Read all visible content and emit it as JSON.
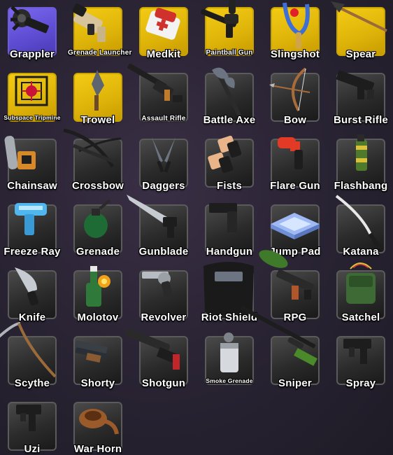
{
  "inventory": {
    "items": [
      {
        "label": "Grappler",
        "rarity": "purple",
        "icon": "grappler-icon"
      },
      {
        "label": "Grenade Launcher",
        "rarity": "gold",
        "icon": "grenade-launcher-icon"
      },
      {
        "label": "Medkit",
        "rarity": "gold",
        "icon": "medkit-icon"
      },
      {
        "label": "Paintball Gun",
        "rarity": "gold",
        "icon": "paintball-gun-icon"
      },
      {
        "label": "Slingshot",
        "rarity": "gold",
        "icon": "slingshot-icon"
      },
      {
        "label": "Spear",
        "rarity": "gold",
        "icon": "spear-icon"
      },
      {
        "label": "Subspace Tripmine",
        "rarity": "gold",
        "icon": "subspace-tripmine-icon"
      },
      {
        "label": "Trowel",
        "rarity": "gold",
        "icon": "trowel-icon"
      },
      {
        "label": "Assault Rifle",
        "rarity": "common",
        "icon": "assault-rifle-icon"
      },
      {
        "label": "Battle Axe",
        "rarity": "common",
        "icon": "battle-axe-icon"
      },
      {
        "label": "Bow",
        "rarity": "common",
        "icon": "bow-icon"
      },
      {
        "label": "Burst Rifle",
        "rarity": "common",
        "icon": "burst-rifle-icon"
      },
      {
        "label": "Chainsaw",
        "rarity": "common",
        "icon": "chainsaw-icon"
      },
      {
        "label": "Crossbow",
        "rarity": "common",
        "icon": "crossbow-icon"
      },
      {
        "label": "Daggers",
        "rarity": "common",
        "icon": "daggers-icon"
      },
      {
        "label": "Fists",
        "rarity": "common",
        "icon": "fists-icon"
      },
      {
        "label": "Flare Gun",
        "rarity": "common",
        "icon": "flare-gun-icon"
      },
      {
        "label": "Flashbang",
        "rarity": "common",
        "icon": "flashbang-icon"
      },
      {
        "label": "Freeze Ray",
        "rarity": "common",
        "icon": "freeze-ray-icon"
      },
      {
        "label": "Grenade",
        "rarity": "common",
        "icon": "grenade-icon"
      },
      {
        "label": "Gunblade",
        "rarity": "common",
        "icon": "gunblade-icon"
      },
      {
        "label": "Handgun",
        "rarity": "common",
        "icon": "handgun-icon"
      },
      {
        "label": "Jump Pad",
        "rarity": "common",
        "icon": "jump-pad-icon"
      },
      {
        "label": "Katana",
        "rarity": "common",
        "icon": "katana-icon"
      },
      {
        "label": "Knife",
        "rarity": "common",
        "icon": "knife-icon"
      },
      {
        "label": "Molotov",
        "rarity": "common",
        "icon": "molotov-icon"
      },
      {
        "label": "Revolver",
        "rarity": "common",
        "icon": "revolver-icon"
      },
      {
        "label": "Riot Shield",
        "rarity": "common",
        "icon": "riot-shield-icon"
      },
      {
        "label": "RPG",
        "rarity": "common",
        "icon": "rpg-icon"
      },
      {
        "label": "Satchel",
        "rarity": "common",
        "icon": "satchel-icon"
      },
      {
        "label": "Scythe",
        "rarity": "common",
        "icon": "scythe-icon"
      },
      {
        "label": "Shorty",
        "rarity": "common",
        "icon": "shorty-icon"
      },
      {
        "label": "Shotgun",
        "rarity": "common",
        "icon": "shotgun-icon"
      },
      {
        "label": "Smoke Grenade",
        "rarity": "common",
        "icon": "smoke-grenade-icon"
      },
      {
        "label": "Sniper",
        "rarity": "common",
        "icon": "sniper-icon"
      },
      {
        "label": "Spray",
        "rarity": "common",
        "icon": "spray-icon"
      },
      {
        "label": "Uzi",
        "rarity": "common",
        "icon": "uzi-icon"
      },
      {
        "label": "War Horn",
        "rarity": "common",
        "icon": "war-horn-icon"
      }
    ]
  },
  "colors": {
    "gold": "#e8bd0c",
    "purple": "#6a58e0",
    "common": "#333333"
  }
}
